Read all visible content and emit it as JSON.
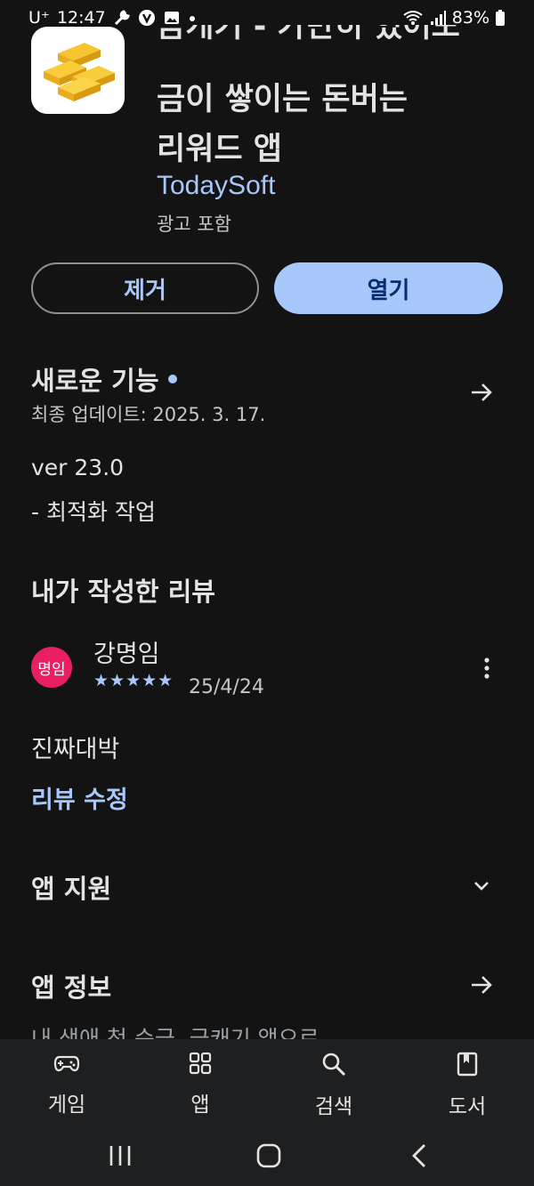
{
  "status_bar": {
    "carrier": "U⁺",
    "time": "12:47",
    "battery": "83%"
  },
  "app": {
    "title_lines": [
      "금캐기 - 가만히 있어도",
      "금이 쌓이는 돈버는",
      "리워드 앱"
    ],
    "developer": "TodaySoft",
    "ads_label": "광고 포함",
    "remove_label": "제거",
    "open_label": "열기"
  },
  "whats_new": {
    "heading": "새로운 기능",
    "last_updated": "최종 업데이트: 2025. 3. 17.",
    "version": "ver 23.0",
    "notes": "- 최적화 작업"
  },
  "my_review": {
    "heading": "내가 작성한 리뷰",
    "avatar_text": "명임",
    "reviewer_name": "강명임",
    "stars": "★★★★★",
    "rating": 5,
    "date": "25/4/24",
    "review_text": "진짜대박",
    "edit_label": "리뷰 수정"
  },
  "app_support": {
    "heading": "앱 지원"
  },
  "app_info": {
    "heading": "앱 정보",
    "preview_text": "내 생애 첫 순금, 금캐기 앱으로"
  },
  "bottom_nav": [
    {
      "label": "게임",
      "icon": "gamepad-icon"
    },
    {
      "label": "앱",
      "icon": "apps-grid-icon"
    },
    {
      "label": "검색",
      "icon": "search-icon"
    },
    {
      "label": "도서",
      "icon": "book-icon"
    }
  ],
  "colors": {
    "background": "#131314",
    "accent": "#a8c7fa",
    "avatar": "#e91e63",
    "nav_background": "#1e1f20"
  }
}
